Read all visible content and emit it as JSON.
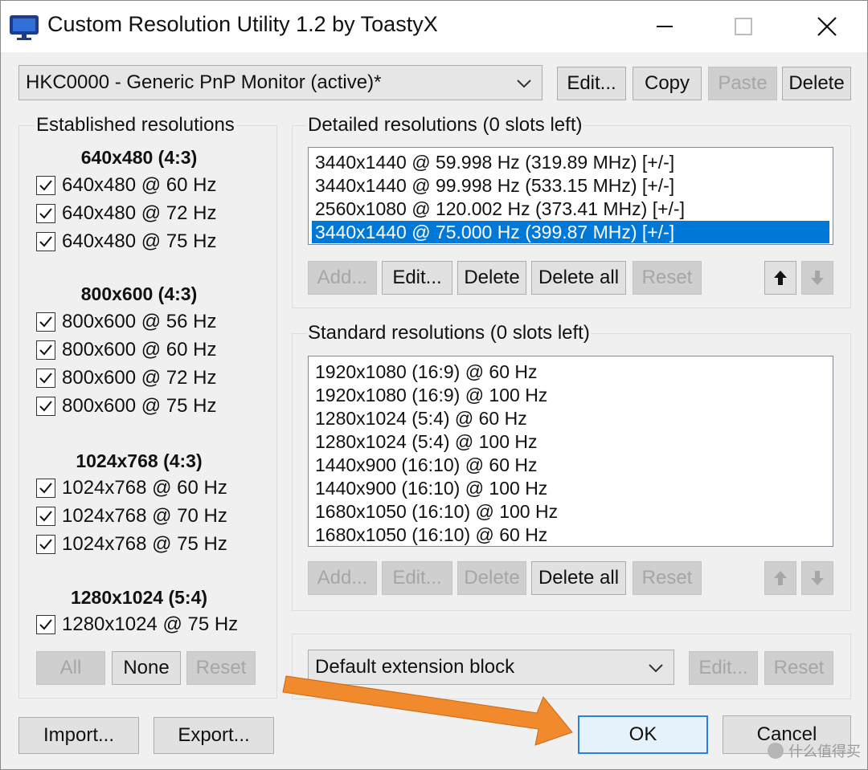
{
  "window": {
    "title": "Custom Resolution Utility 1.2 by ToastyX",
    "icon": "monitor-icon",
    "controls": [
      "minimize-icon",
      "maximize-icon",
      "close-icon"
    ]
  },
  "monitor_select": {
    "value": "HKC0000 - Generic PnP Monitor (active)*",
    "buttons": {
      "edit": "Edit...",
      "copy": "Copy",
      "paste": "Paste",
      "delete": "Delete"
    }
  },
  "established": {
    "title": "Established resolutions",
    "groups": [
      {
        "heading": "640x480 (4:3)",
        "items": [
          "640x480 @ 60 Hz",
          "640x480 @ 72 Hz",
          "640x480 @ 75 Hz"
        ]
      },
      {
        "heading": "800x600 (4:3)",
        "items": [
          "800x600 @ 56 Hz",
          "800x600 @ 60 Hz",
          "800x600 @ 72 Hz",
          "800x600 @ 75 Hz"
        ]
      },
      {
        "heading": "1024x768 (4:3)",
        "items": [
          "1024x768 @ 60 Hz",
          "1024x768 @ 70 Hz",
          "1024x768 @ 75 Hz"
        ]
      },
      {
        "heading": "1280x1024 (5:4)",
        "items": [
          "1280x1024 @ 75 Hz"
        ]
      }
    ],
    "buttons": {
      "all": "All",
      "none": "None",
      "reset": "Reset"
    }
  },
  "detailed": {
    "title": "Detailed resolutions (0 slots left)",
    "items": [
      "3440x1440 @ 59.998 Hz (319.89 MHz) [+/-]",
      "3440x1440 @ 99.998 Hz (533.15 MHz) [+/-]",
      "2560x1080 @ 120.002 Hz (373.41 MHz) [+/-]",
      "3440x1440 @ 75.000 Hz (399.87 MHz) [+/-]"
    ],
    "selected_index": 3,
    "buttons": {
      "add": "Add...",
      "edit": "Edit...",
      "delete": "Delete",
      "delete_all": "Delete all",
      "reset": "Reset"
    }
  },
  "standard": {
    "title": "Standard resolutions (0 slots left)",
    "items": [
      "1920x1080 (16:9) @ 60 Hz",
      "1920x1080 (16:9) @ 100 Hz",
      "1280x1024 (5:4) @ 60 Hz",
      "1280x1024 (5:4) @ 100 Hz",
      "1440x900 (16:10) @ 60 Hz",
      "1440x900 (16:10) @ 100 Hz",
      "1680x1050 (16:10) @ 100 Hz",
      "1680x1050 (16:10) @ 60 Hz"
    ],
    "buttons": {
      "add": "Add...",
      "edit": "Edit...",
      "delete": "Delete",
      "delete_all": "Delete all",
      "reset": "Reset"
    }
  },
  "extension": {
    "value": "Default extension block",
    "buttons": {
      "edit": "Edit...",
      "reset": "Reset"
    }
  },
  "footer": {
    "import": "Import...",
    "export": "Export...",
    "ok": "OK",
    "cancel": "Cancel"
  },
  "watermark": {
    "text": "什么值得买"
  },
  "colors": {
    "selection": "#0078d7",
    "annotation_arrow": "#f08a2c",
    "default_button_border": "#2a7fe0"
  }
}
